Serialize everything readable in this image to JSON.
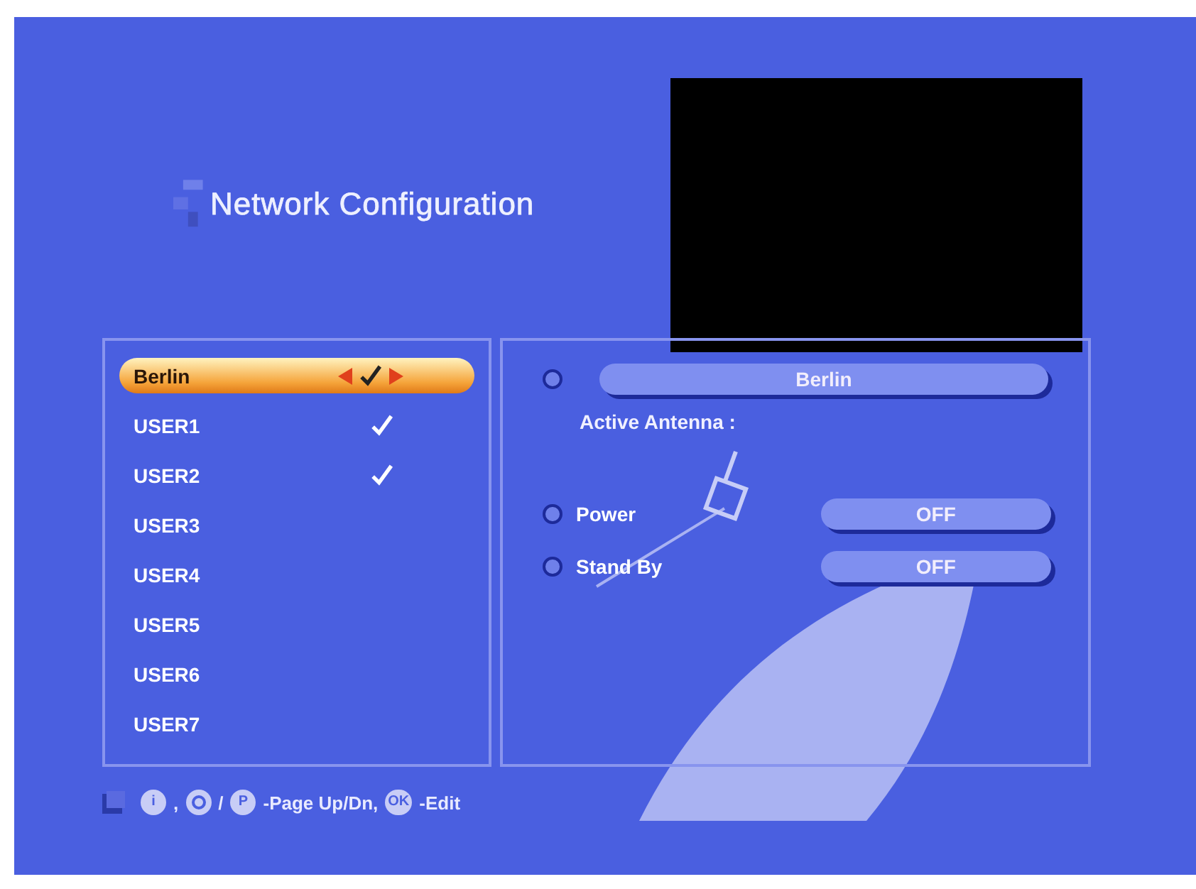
{
  "title": "Network Configuration",
  "users": [
    {
      "name": "Berlin",
      "selected": true,
      "checked": true
    },
    {
      "name": "USER1",
      "selected": false,
      "checked": true
    },
    {
      "name": "USER2",
      "selected": false,
      "checked": true
    },
    {
      "name": "USER3",
      "selected": false,
      "checked": false
    },
    {
      "name": "USER4",
      "selected": false,
      "checked": false
    },
    {
      "name": "USER5",
      "selected": false,
      "checked": false
    },
    {
      "name": "USER6",
      "selected": false,
      "checked": false
    },
    {
      "name": "USER7",
      "selected": false,
      "checked": false
    }
  ],
  "detail": {
    "name": "Berlin",
    "antenna_label": "Active Antenna :",
    "settings": [
      {
        "label": "Power",
        "value": "OFF"
      },
      {
        "label": "Stand By",
        "value": "OFF"
      }
    ]
  },
  "footer": [
    {
      "kind": "key",
      "label": "i"
    },
    {
      "kind": "text",
      "text": ","
    },
    {
      "kind": "power-key"
    },
    {
      "kind": "text",
      "text": "/"
    },
    {
      "kind": "key",
      "label": "P"
    },
    {
      "kind": "text",
      "text": "-Page Up/Dn,"
    },
    {
      "kind": "key",
      "label": "OK"
    },
    {
      "kind": "text",
      "text": "-Edit"
    }
  ]
}
